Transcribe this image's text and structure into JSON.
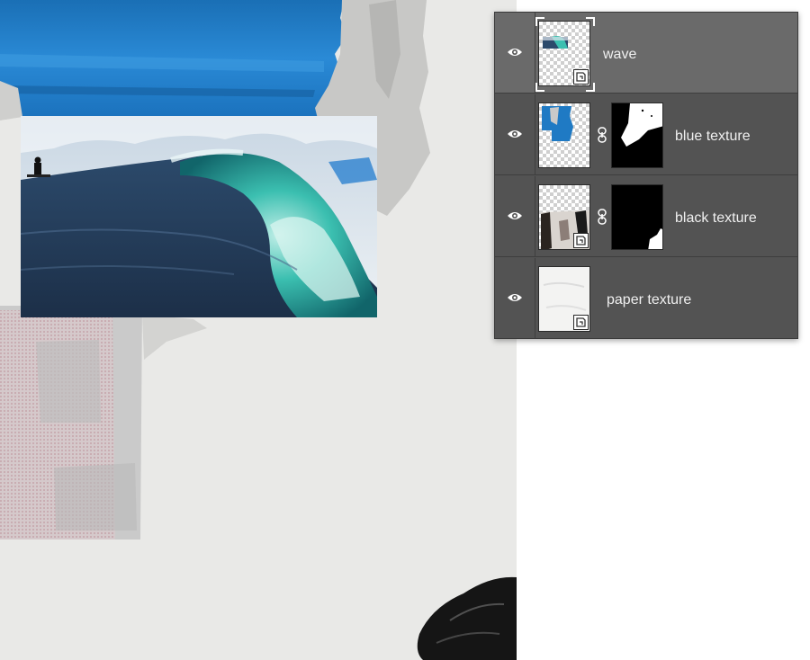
{
  "layers_panel": {
    "layers": [
      {
        "name": "wave",
        "visible": true,
        "selected": true,
        "thumbnail_icon": "wave-thumbnail",
        "has_mask": false,
        "smart_object": true
      },
      {
        "name": "blue texture",
        "visible": true,
        "selected": false,
        "thumbnail_icon": "blue-texture-thumbnail",
        "has_mask": true,
        "smart_object": false
      },
      {
        "name": "black texture",
        "visible": true,
        "selected": false,
        "thumbnail_icon": "black-texture-thumbnail",
        "has_mask": true,
        "smart_object": true
      },
      {
        "name": "paper texture",
        "visible": true,
        "selected": false,
        "thumbnail_icon": "paper-texture-thumbnail",
        "has_mask": false,
        "smart_object": true
      }
    ]
  },
  "colors": {
    "panel_bg": "#535353",
    "selected_row": "#6a6a6a",
    "sky_blue": "#1f7ac4",
    "wave_teal": "#1f9a8f",
    "paper": "#e9e9e7"
  }
}
